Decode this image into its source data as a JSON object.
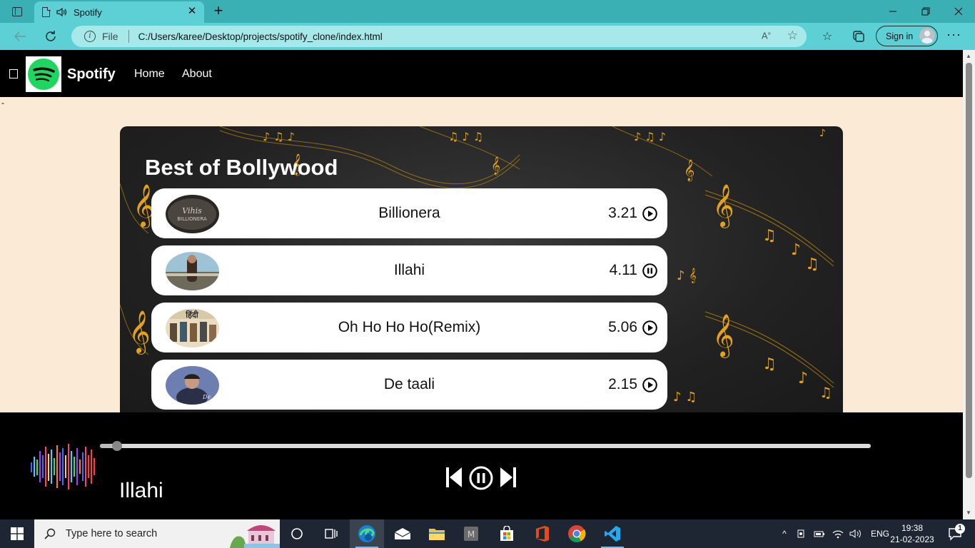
{
  "browser": {
    "tab_title": "Spotify",
    "address_scheme_label": "File",
    "url": "C:/Users/karee/Desktop/projects/spotify_clone/index.html",
    "signin_label": "Sign in"
  },
  "site": {
    "brand": "Spotify",
    "nav": [
      "Home",
      "About"
    ],
    "dash": "-"
  },
  "playlist": {
    "title": "Best of Bollywood",
    "songs": [
      {
        "name": "Billionera",
        "duration": "3.21",
        "state": "play"
      },
      {
        "name": "Illahi",
        "duration": "4.11",
        "state": "pause"
      },
      {
        "name": "Oh Ho Ho Ho(Remix)",
        "duration": "5.06",
        "state": "play"
      },
      {
        "name": "De taali",
        "duration": "2.15",
        "state": "play"
      }
    ]
  },
  "player": {
    "now_playing": "Illahi",
    "progress_fraction": 0.016
  },
  "taskbar": {
    "search_placeholder": "Type here to search",
    "language": "ENG",
    "time": "19:38",
    "date": "21-02-2023",
    "notification_count": "1"
  },
  "colors": {
    "browser_frame": "#3ab0b5",
    "address_bar": "#5cd0d4",
    "page_background": "#fbead6",
    "navbar": "#000000",
    "spotify_green": "#1ed760",
    "taskbar": "#1f2633"
  }
}
